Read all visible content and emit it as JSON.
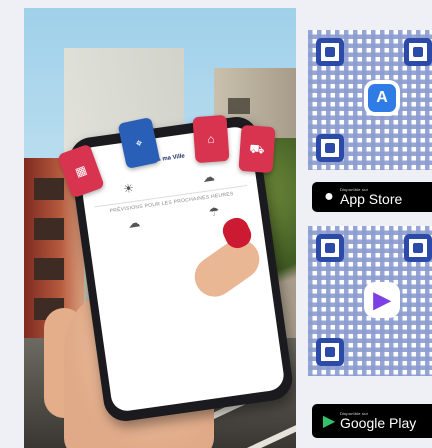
{
  "photo": {
    "phone_app": {
      "header_title": "Dans ma Ville",
      "sections": [
        {
          "label": "PRÉVISIONS POUR LES PROCHAINES HEURES"
        }
      ],
      "side_tabs": [
        {
          "icon": "map-icon",
          "label": ""
        },
        {
          "icon": "calendar-icon",
          "label": ""
        },
        {
          "icon": "store-icon",
          "label": ""
        },
        {
          "icon": "bus-icon",
          "label": ""
        }
      ],
      "weather_rows": [
        [
          {
            "icon": "☀",
            "text": ""
          },
          {
            "icon": "☁",
            "text": ""
          }
        ],
        [
          {
            "icon": "☁",
            "text": ""
          },
          {
            "icon": "☂",
            "text": ""
          }
        ]
      ]
    }
  },
  "stores": {
    "app_store": {
      "small_label": "Disponible sur",
      "label": "App Store",
      "icon": "apple-icon"
    },
    "google_play": {
      "small_label": "Disponible sur",
      "label": "Google Play",
      "icon": "google-play-icon"
    }
  },
  "colors": {
    "qr_blue": "#2c4aa8",
    "app_store_blue": "#2f7ce6",
    "play_purple": "#7b3fe4"
  }
}
